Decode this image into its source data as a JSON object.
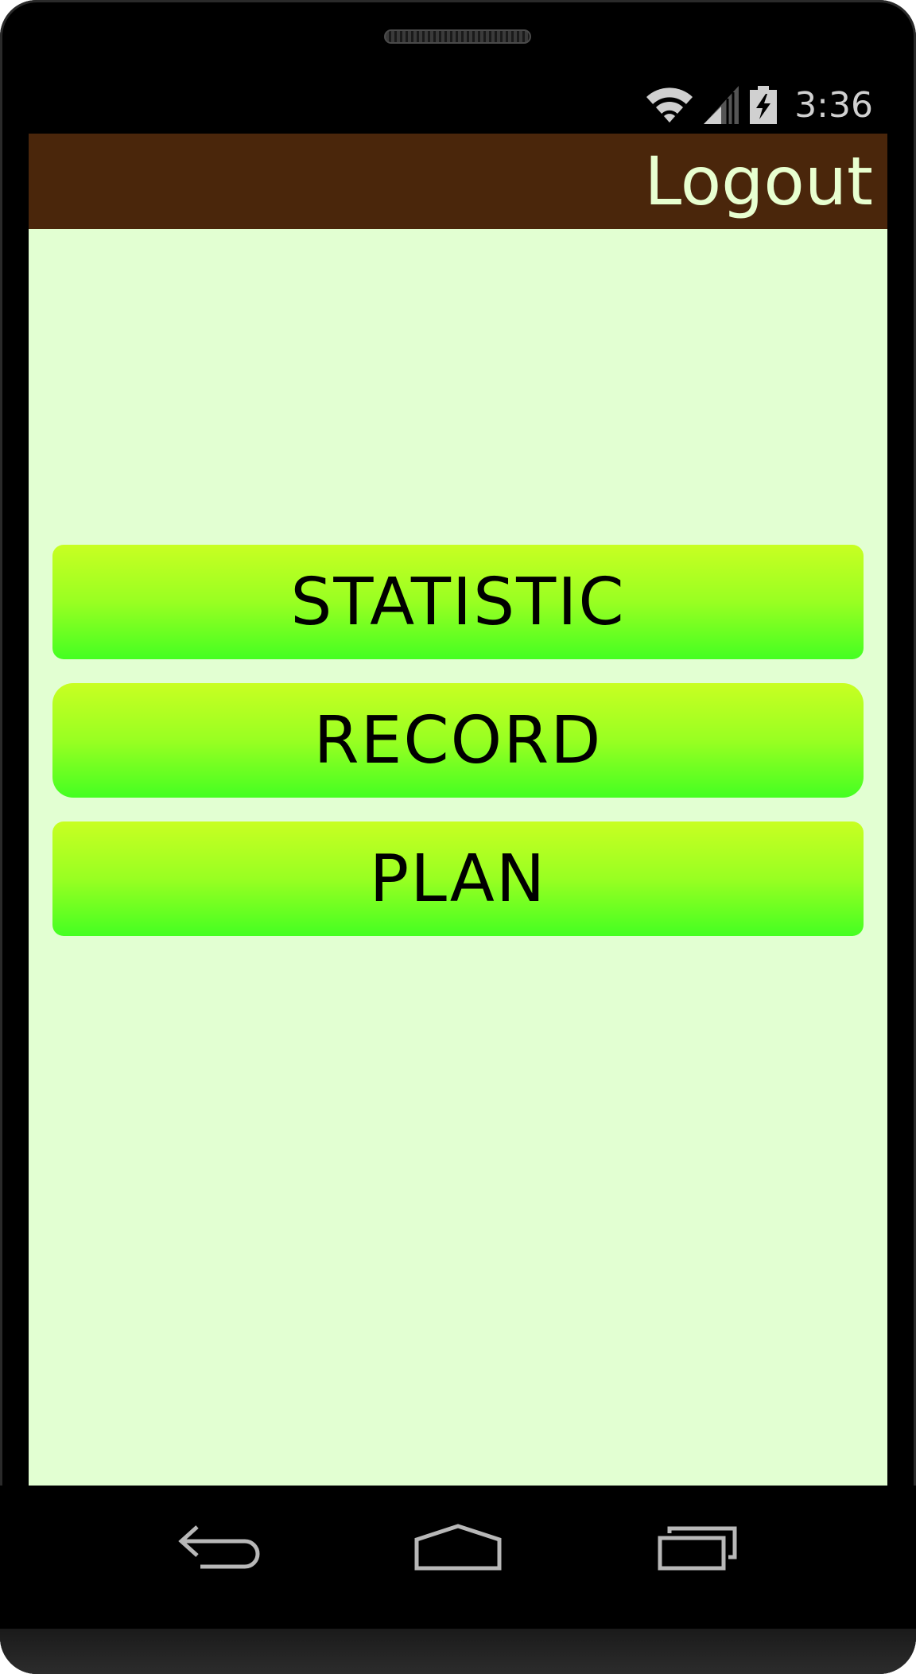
{
  "status_bar": {
    "time": "3:36",
    "icons": [
      "wifi-icon",
      "cell-signal-icon",
      "battery-charging-icon"
    ]
  },
  "title_bar": {
    "logout_label": "Logout",
    "color": "#4a260b",
    "text_color": "#e8ffd0"
  },
  "screen": {
    "background": "#e2ffd2"
  },
  "menu": {
    "buttons": [
      {
        "label": "STATISTIC"
      },
      {
        "label": "RECORD"
      },
      {
        "label": "PLAN"
      }
    ],
    "gradient_top": "#c8ff22",
    "gradient_bottom": "#44ff22"
  },
  "nav_bar": {
    "icons": [
      "back-icon",
      "home-icon",
      "recent-apps-icon"
    ]
  }
}
